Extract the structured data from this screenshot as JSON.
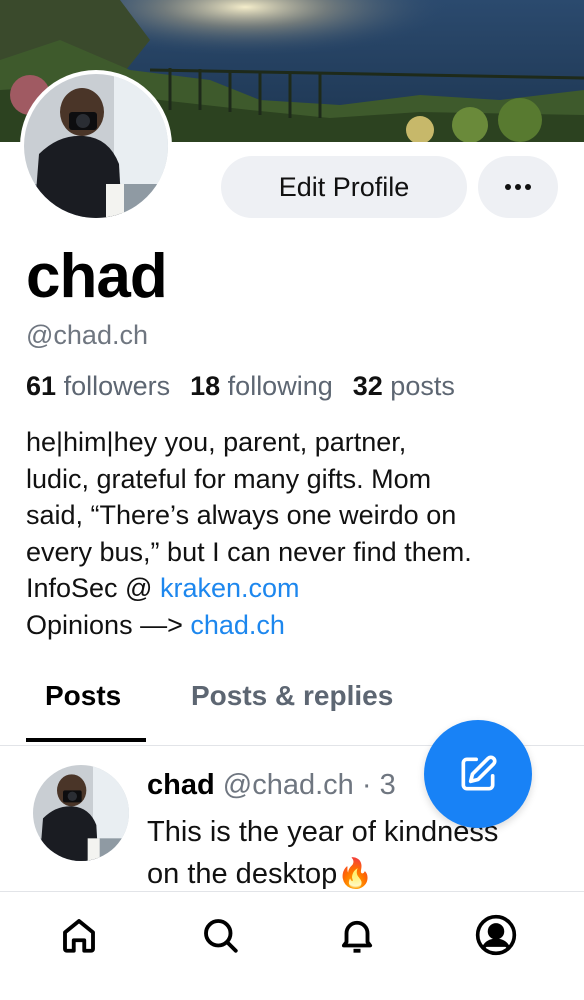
{
  "profile": {
    "display_name": "chad",
    "handle": "@chad.ch",
    "edit_label": "Edit Profile",
    "more_icon": "ellipsis-icon"
  },
  "stats": {
    "followers_count": "61",
    "followers_label": "followers",
    "following_count": "18",
    "following_label": "following",
    "posts_count": "32",
    "posts_label": "posts"
  },
  "bio": {
    "line1": "he|him|hey you, parent, partner,",
    "line2": "ludic, grateful for many gifts. Mom",
    "line3": "said, “There’s always one weirdo on",
    "line4": "every bus,” but I can never find them.",
    "line5_prefix": "InfoSec @ ",
    "line5_link": "kraken.com",
    "line6_prefix": "Opinions —> ",
    "line6_link": "chad.ch"
  },
  "tabs": [
    {
      "label": "Posts",
      "active": true
    },
    {
      "label": "Posts & replies",
      "active": false
    }
  ],
  "post": {
    "author": "chad",
    "handle": "@chad.ch",
    "separator": "·",
    "time": "3",
    "text_line1": "This is the year of kindness",
    "text_line2": "on the desktop",
    "emoji": "🔥"
  },
  "nav": {
    "items": [
      "home-icon",
      "search-icon",
      "notifications-icon",
      "profile-icon"
    ]
  },
  "fab": {
    "icon": "compose-icon"
  },
  "colors": {
    "link": "#1d87ee",
    "fab": "#1882f6",
    "muted": "#6f7680",
    "button_bg": "#eef0f4"
  }
}
